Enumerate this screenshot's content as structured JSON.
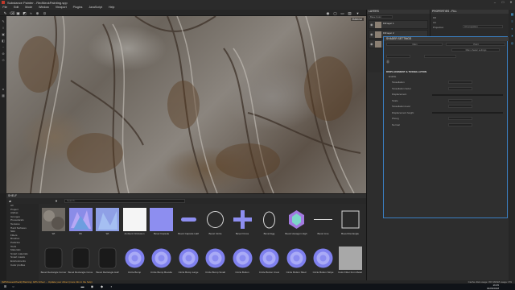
{
  "window": {
    "title": "Substance Painter - RedNeckPainting.spp",
    "controls": [
      "–",
      "□",
      "✕"
    ]
  },
  "menu": [
    "File",
    "Edit",
    "Mode",
    "Window",
    "Viewport",
    "Plugins",
    "JavaScript",
    "Help"
  ],
  "viewport": {
    "fps": "Material"
  },
  "layers": {
    "title": "LAYERS",
    "blend_label": "Base Color",
    "rows": [
      {
        "name": "Fill layer 1"
      },
      {
        "name": "Fill layer 2"
      },
      {
        "name": "Layer 1"
      }
    ]
  },
  "properties": {
    "title": "PROPERTIES - FILL",
    "rows": [
      "Fill",
      "UV",
      "Projection",
      "UV projection"
    ]
  },
  "shader": {
    "title": "SHADER SETTINGS",
    "tabs": [
      "Main",
      "Paint"
    ],
    "preset_label": "Main shader settings",
    "section_title": "DISPLACEMENT & TESSELLATION",
    "enable_label": "Enable",
    "rows": [
      "Tessellation",
      "Tessellation factor",
      "Displacement",
      "Scale",
      "Tessellation level",
      "Displacement height",
      "Phong",
      "Normal"
    ]
  },
  "shelf": {
    "title": "SHELF",
    "search_placeholder": "Search...",
    "categories": [
      "All",
      "Project",
      "Alphas",
      "Grunges",
      "Procedurals",
      "Textures",
      "Hard Surfaces",
      "Skin",
      "Filters",
      "Brushes",
      "Particles",
      "Tools",
      "Materials",
      "Smart materials",
      "Smart masks",
      "Environments",
      "Color profiles"
    ],
    "items": [
      {
        "name": "Wt",
        "kind": "rock"
      },
      {
        "name": "Wt",
        "kind": "normal-rock"
      },
      {
        "name": "Wt",
        "kind": "normal-rock2"
      },
      {
        "name": "Ambient Occlusion",
        "kind": "white"
      },
      {
        "name": "Bevel Capsule",
        "kind": "normal-flat"
      },
      {
        "name": "Bevel Capsule Half",
        "kind": "capsule"
      },
      {
        "name": "Bevel Circle",
        "kind": "circle"
      },
      {
        "name": "Bevel Cross",
        "kind": "cross"
      },
      {
        "name": "Bevel Egg",
        "kind": "egg"
      },
      {
        "name": "Bevel Hexagon High",
        "kind": "hex"
      },
      {
        "name": "Bevel Line",
        "kind": "line"
      },
      {
        "name": "Bevel Rectangle",
        "kind": "rect"
      },
      {
        "name": "Bevel Rectangle Corner",
        "kind": "roundrect"
      },
      {
        "name": "Bevel Rectangle Curve",
        "kind": "roundrect"
      },
      {
        "name": "Bevel Rectangle Half",
        "kind": "roundrect"
      },
      {
        "name": "Circle Bump",
        "kind": "bump"
      },
      {
        "name": "Circle Bump Bevelle",
        "kind": "bump"
      },
      {
        "name": "Circle Bump Large",
        "kind": "bump"
      },
      {
        "name": "Circle Bump Small",
        "kind": "bump"
      },
      {
        "name": "Circle Button",
        "kind": "bump"
      },
      {
        "name": "Circle Button Crest",
        "kind": "bump"
      },
      {
        "name": "Circle Button Slted",
        "kind": "bump"
      },
      {
        "name": "Circle Button Stripe",
        "kind": "bump"
      },
      {
        "name": "Color Filter from Metal",
        "kind": "gray"
      }
    ]
  },
  "status": {
    "message": "[GPUIssuesCheck] Warning: GPU driver ... Update your driver (more info in the help)",
    "right": "Cache disk usage: 0%  VRAM usage: 0%"
  },
  "taskbar": {
    "time": "16:35",
    "date": "04/05/2018"
  },
  "colors": {
    "accent": "#3a7fc2",
    "bump": "#8d8ef0",
    "status_warning": "#e8a43a"
  }
}
